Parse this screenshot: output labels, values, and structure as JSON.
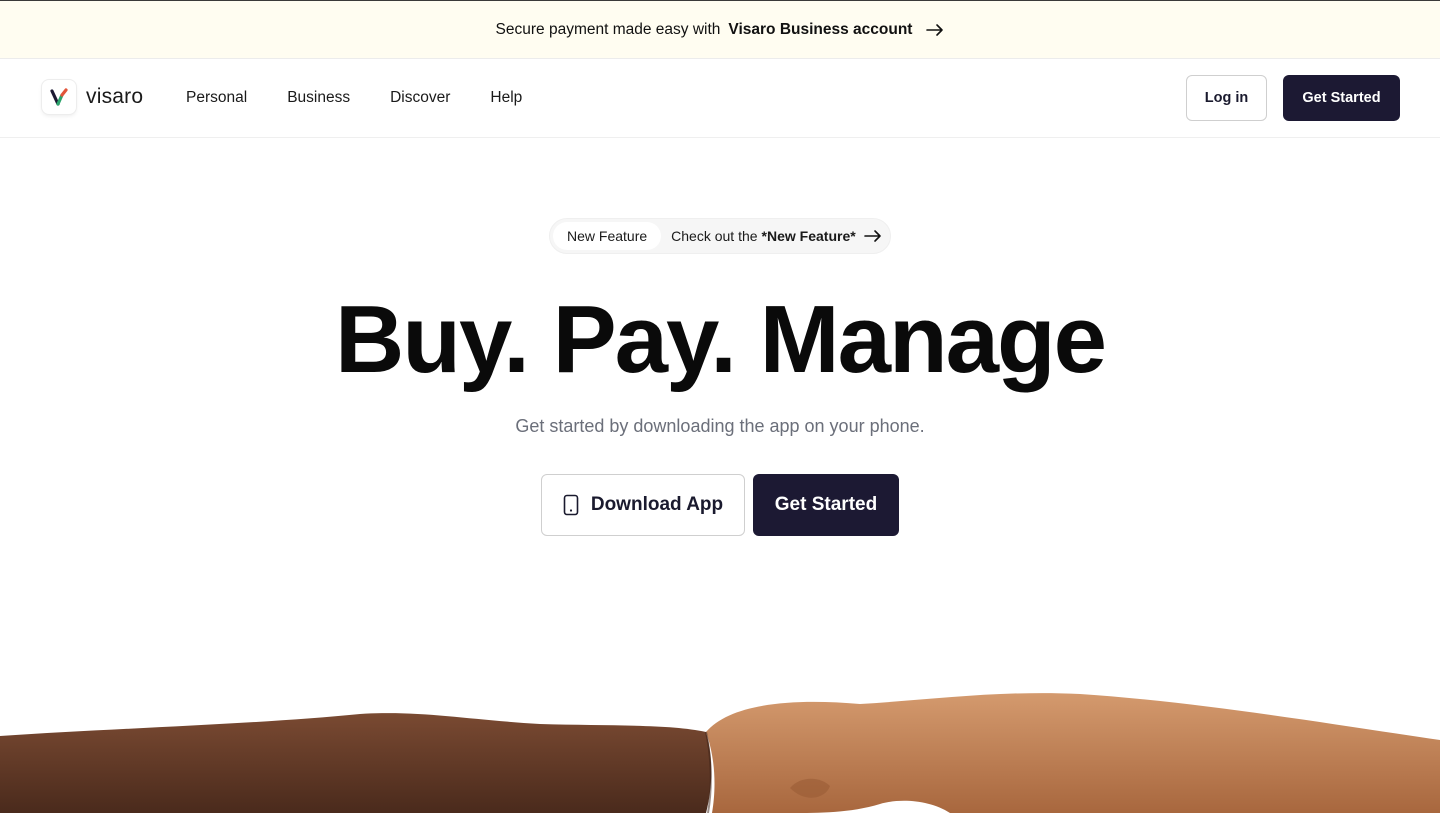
{
  "announcement": {
    "prefix": "Secure payment made easy with",
    "highlight": "Visaro Business account"
  },
  "brand": {
    "name": "visaro"
  },
  "nav": {
    "links": [
      "Personal",
      "Business",
      "Discover",
      "Help"
    ],
    "login_label": "Log in",
    "get_started_label": "Get Started"
  },
  "feature_pill": {
    "tag": "New Feature",
    "text_prefix": "Check out the",
    "text_highlight": "*New Feature*"
  },
  "hero": {
    "headline": "Buy. Pay. Manage",
    "subline": "Get started by downloading the app on your phone.",
    "download_label": "Download App",
    "get_started_label": "Get Started"
  },
  "colors": {
    "accent_dark": "#1c1933",
    "banner_bg": "#fffdf1",
    "skin_dark": "#6a3f2a",
    "skin_light": "#c98e63"
  },
  "icons": {
    "announcement_arrow": "arrow-right-icon",
    "pill_arrow": "arrow-right-icon",
    "download": "phone-icon",
    "logo": "visaro-logo-icon"
  }
}
